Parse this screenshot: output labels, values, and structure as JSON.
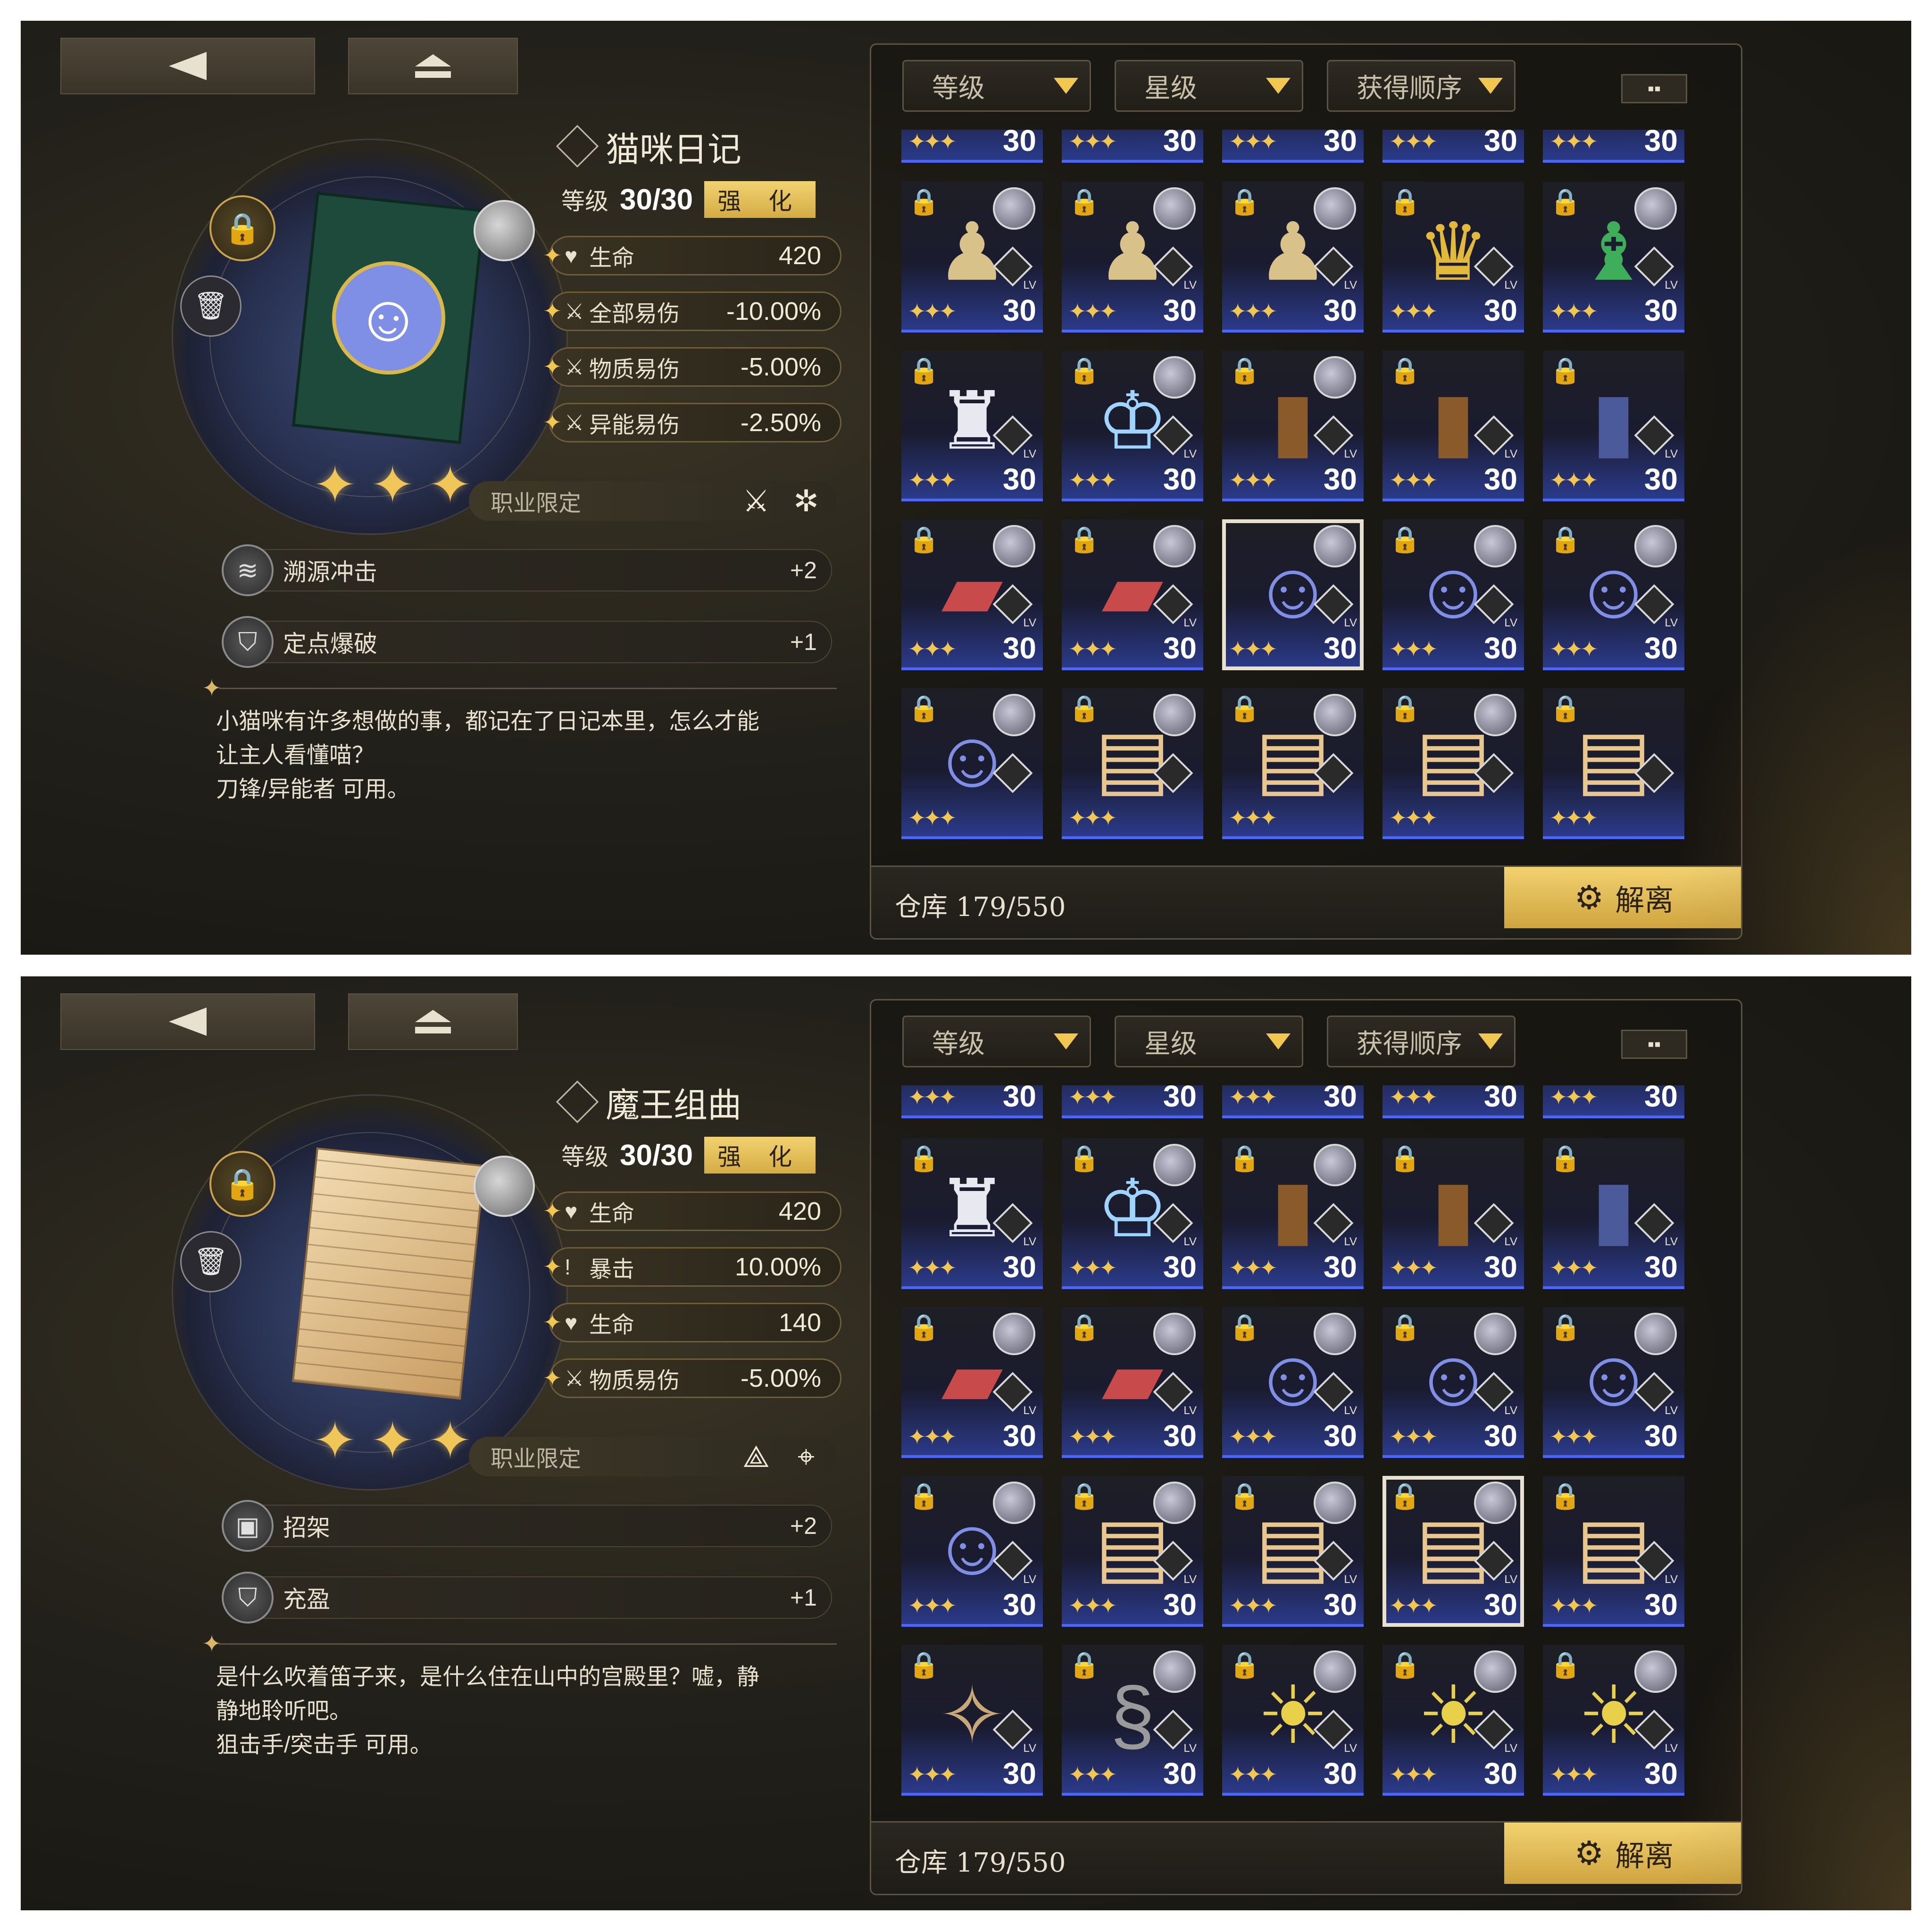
{
  "panels": [
    {
      "item": {
        "name": "猫咪日记",
        "level_label": "等级",
        "level_value": "30/30",
        "enhance_label": "强 化",
        "rarity_stars": 3,
        "art": "cheshire-cat-book"
      },
      "stats": [
        {
          "icon": "heart-icon",
          "label": "生命",
          "value": "420"
        },
        {
          "icon": "sword-icon",
          "label": "全部易伤",
          "value": "-10.00%"
        },
        {
          "icon": "sword-icon",
          "label": "物质易伤",
          "value": "-5.00%"
        },
        {
          "icon": "sword-icon",
          "label": "异能易伤",
          "value": "-2.50%"
        }
      ],
      "class_limit": {
        "label": "职业限定"
      },
      "skills": [
        {
          "name": "溯源冲击",
          "level": "+2"
        },
        {
          "name": "定点爆破",
          "level": "+1"
        }
      ],
      "description": [
        "小猫咪有许多想做的事，都记在了日记本里，怎么才能",
        "让主人看懂喵？",
        "刀锋/异能者 可用。"
      ]
    },
    {
      "item": {
        "name": "魔王组曲",
        "level_label": "等级",
        "level_value": "30/30",
        "enhance_label": "强 化",
        "rarity_stars": 3,
        "art": "sheet-music"
      },
      "stats": [
        {
          "icon": "heart-icon",
          "label": "生命",
          "value": "420"
        },
        {
          "icon": "crit-icon",
          "label": "暴击",
          "value": "10.00%"
        },
        {
          "icon": "heart-icon",
          "label": "生命",
          "value": "140"
        },
        {
          "icon": "sword-icon",
          "label": "物质易伤",
          "value": "-5.00%"
        }
      ],
      "class_limit": {
        "label": "职业限定"
      },
      "skills": [
        {
          "name": "招架",
          "level": "+2"
        },
        {
          "name": "充盈",
          "level": "+1"
        }
      ],
      "description": [
        "是什么吹着笛子来，是什么住在山中的宫殿里？嘘，静",
        "静地聆听吧。",
        "狙击手/突击手 可用。"
      ]
    }
  ],
  "inventory": {
    "sort_buttons": [
      "等级",
      "星级",
      "获得顺序"
    ],
    "storage_label": "仓库 179/550",
    "dismantle_label": "解离",
    "lv_tag": "LV",
    "level_tag": "30"
  },
  "colors": {
    "accent_gold": "#f2c750",
    "button_gold": "#e2bc55",
    "rarity_blue": "#4b66ff"
  },
  "icons": [
    "back-icon",
    "home-icon",
    "lock-icon",
    "trash-icon",
    "heart-icon",
    "sword-icon",
    "crit-icon",
    "grid-view-icon",
    "dismantle-icon"
  ]
}
